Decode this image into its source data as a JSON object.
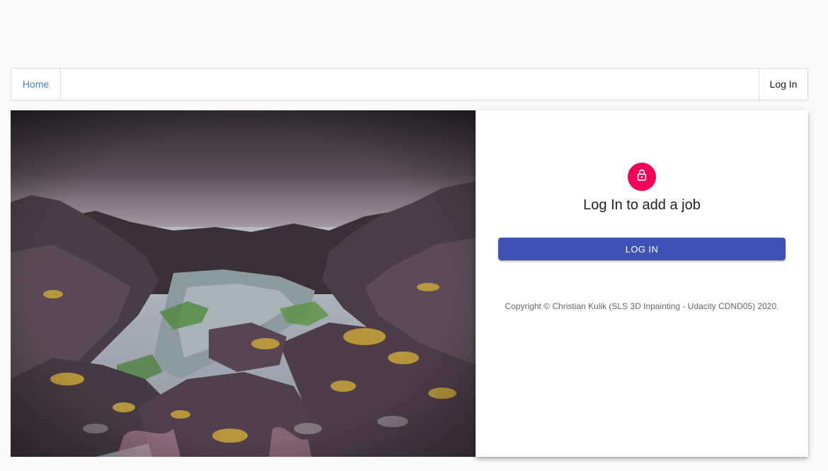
{
  "nav": {
    "home_label": "Home",
    "login_label": "Log In"
  },
  "hero": {
    "description": "rocky coastline landscape photo"
  },
  "panel": {
    "icon": "lock-icon",
    "heading": "Log In to add a job",
    "login_button_label": "LOG IN",
    "copyright": "Copyright © Christian Kulik (SLS 3D Inpainting - Udacity CDND05) 2020."
  },
  "colors": {
    "accent": "#3f51b5",
    "avatar": "#f50057",
    "link": "#4183c4"
  }
}
